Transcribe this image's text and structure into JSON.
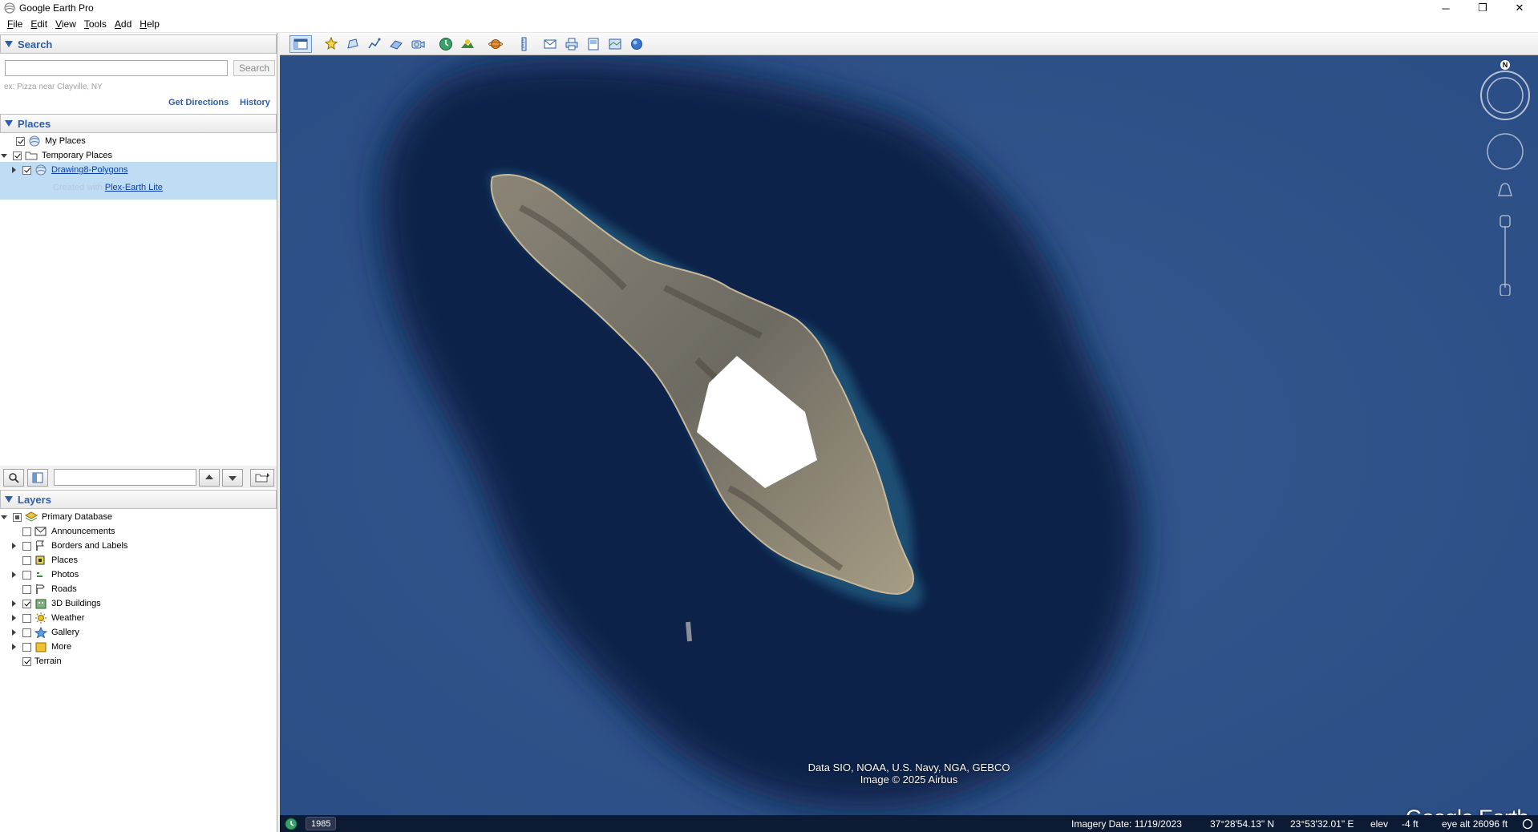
{
  "window": {
    "title": "Google Earth Pro",
    "minimize": "─",
    "restore": "❐",
    "close": "✕"
  },
  "menu": [
    {
      "label": "File",
      "key": "F",
      "rest": "ile"
    },
    {
      "label": "Edit",
      "key": "E",
      "rest": "dit"
    },
    {
      "label": "View",
      "key": "V",
      "rest": "iew"
    },
    {
      "label": "Tools",
      "key": "T",
      "rest": "ools"
    },
    {
      "label": "Add",
      "key": "A",
      "rest": "dd"
    },
    {
      "label": "Help",
      "key": "H",
      "rest": "elp"
    }
  ],
  "search": {
    "header": "Search",
    "value": "",
    "button": "Search",
    "hint": "ex: Pizza near Clayville, NY",
    "get_directions": "Get Directions",
    "history": "History"
  },
  "places": {
    "header": "Places",
    "items": [
      {
        "label": "My Places",
        "checked": true
      },
      {
        "label": "Temporary Places",
        "checked": true
      },
      {
        "label": "Drawing8-Polygons",
        "checked": true
      },
      {
        "description_prefix": "Created with ",
        "description_link": "Plex-Earth Lite"
      }
    ]
  },
  "layers": {
    "header": "Layers",
    "items": [
      {
        "label": "Primary Database",
        "state": "partial"
      },
      {
        "label": "Announcements",
        "checked": false
      },
      {
        "label": "Borders and Labels",
        "checked": false
      },
      {
        "label": "Places",
        "checked": false
      },
      {
        "label": "Photos",
        "checked": false
      },
      {
        "label": "Roads",
        "checked": false
      },
      {
        "label": "3D Buildings",
        "checked": true
      },
      {
        "label": "Weather",
        "checked": false
      },
      {
        "label": "Gallery",
        "checked": false
      },
      {
        "label": "More",
        "checked": false
      },
      {
        "label": "Terrain",
        "checked": true
      }
    ]
  },
  "map": {
    "compass_north": "N",
    "attribution_line1": "Data SIO, NOAA, U.S. Navy, NGA, GEBCO",
    "attribution_line2": "Image © 2025 Airbus",
    "logo": "Google Earth",
    "status": {
      "year": "1985",
      "imagery_date": "Imagery Date: 11/19/2023",
      "lat": "37°28'54.13\" N",
      "lon": "23°53'32.01\" E",
      "elev_label": "elev",
      "elev_value": "-4 ft",
      "eye_alt": "eye alt  26096 ft"
    }
  },
  "colors": {
    "accent": "#2e5fa5",
    "selection": "#bfdcf5",
    "link": "#0b3ea5",
    "ocean": "#2c4f86",
    "statusbar": "#0c1a33"
  }
}
